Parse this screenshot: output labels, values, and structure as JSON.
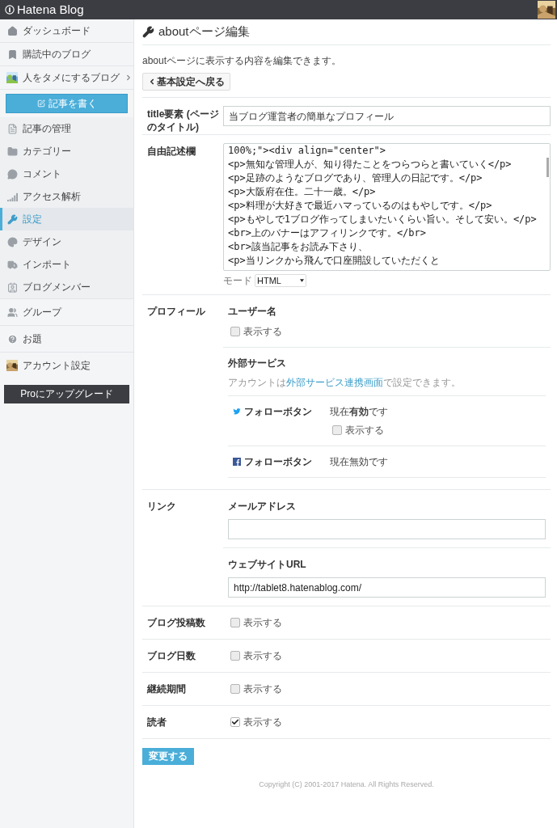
{
  "header": {
    "logo": "Hatena Blog"
  },
  "sidebar": {
    "items": [
      {
        "label": "ダッシュボード",
        "selected": false
      },
      {
        "label": "購読中のブログ",
        "selected": false
      },
      {
        "label": "人をタメにするブログ",
        "selected": false
      }
    ],
    "write_button": "記事を書く",
    "blog_items": [
      {
        "label": "記事の管理",
        "selected": false
      },
      {
        "label": "カテゴリー",
        "selected": false
      },
      {
        "label": "コメント",
        "selected": false
      },
      {
        "label": "アクセス解析",
        "selected": false
      },
      {
        "label": "設定",
        "selected": true
      },
      {
        "label": "デザイン",
        "selected": false
      },
      {
        "label": "インポート",
        "selected": false
      },
      {
        "label": "ブログメンバー",
        "selected": false
      }
    ],
    "more_items": [
      {
        "label": "グループ",
        "selected": false
      },
      {
        "label": "お題",
        "selected": false
      },
      {
        "label": "アカウント設定",
        "selected": false
      }
    ],
    "upgrade_button": "Proにアップグレード"
  },
  "page": {
    "title": "aboutページ編集",
    "description": "aboutページに表示する内容を編集できます。",
    "back_button": "基本設定へ戻る"
  },
  "form": {
    "title_field": {
      "label": "title要素 (ページのタイトル)",
      "value": "当ブログ運営者の簡単なプロフィール"
    },
    "free_text": {
      "label": "自由記述欄",
      "lines": [
        "100%;\"><div align=\"center\">",
        "<p>無知な管理人が、知り得たことをつらつらと書いていく</p>",
        "<p>足跡のようなブログであり、管理人の日記です。</p>",
        "<p>大阪府在住。二十一歳。</p>",
        "<p>料理が大好きで最近ハマっているのはもやしです。</p>",
        "<p>もやしで1ブログ作ってしまいたいくらい旨い。そして安い。</p>",
        "<br>上のバナーはアフィリンクです。</br>",
        "<br>該当記事をお読み下さり、",
        "<p>当リンクから飛んで口座開設していただくと"
      ],
      "mode_label": "モード",
      "mode_value": "HTML"
    },
    "profile": {
      "label": "プロフィール",
      "username": {
        "heading": "ユーザー名",
        "checkbox_label": "表示する",
        "checked": false
      },
      "external": {
        "heading": "外部サービス",
        "note_before": "アカウントは",
        "note_link": "外部サービス連携画面",
        "note_after": "で設定できます。",
        "services": [
          {
            "label": "フォローボタン",
            "status": "現在**有効**です",
            "checkbox": {
              "label": "表示する",
              "checked": false
            }
          },
          {
            "label": "フォローボタン",
            "status": "現在無効です"
          }
        ]
      }
    },
    "link": {
      "label": "リンク",
      "email": {
        "heading": "メールアドレス"
      },
      "website": {
        "heading": "ウェブサイトURL",
        "value": "http://tablet8.hatenablog.com/"
      }
    },
    "options": [
      {
        "label": "ブログ投稿数",
        "checkbox_label": "表示する",
        "checked": false
      },
      {
        "label": "ブログ日数",
        "checkbox_label": "表示する",
        "checked": false
      },
      {
        "label": "継続期間",
        "checkbox_label": "表示する",
        "checked": false
      },
      {
        "label": "読者",
        "checkbox_label": "表示する",
        "checked": true
      }
    ],
    "submit_button": "変更する"
  },
  "footer": "Copyright (C) 2001-2017 Hatena. All Rights Reserved."
}
